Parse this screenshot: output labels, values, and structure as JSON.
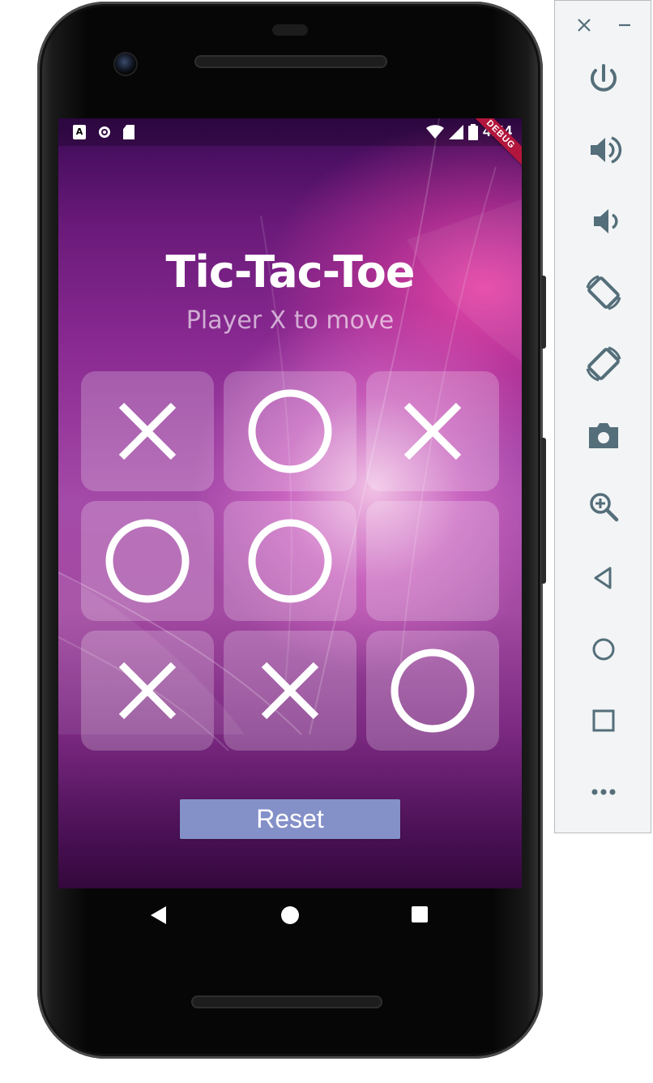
{
  "app": {
    "title": "Tic-Tac-Toe",
    "status": "Player X to move",
    "reset_label": "Reset",
    "colors": {
      "cell_background": "rgba(255,255,255,0.22)",
      "mark": "#ffffff",
      "reset_button": "#8490c8",
      "debug_ribbon": "#b3163c"
    }
  },
  "status_bar": {
    "time": "4:44",
    "left_icons": [
      "accessibility-a-icon",
      "screen-record-icon",
      "sd-card-icon"
    ],
    "right_icons": [
      "wifi-icon",
      "cell-signal-icon",
      "battery-icon"
    ],
    "debug_banner": "DEBUG"
  },
  "board": {
    "cells": [
      "X",
      "O",
      "X",
      "O",
      "O",
      "",
      "X",
      "X",
      "O"
    ]
  },
  "nav_bar": {
    "buttons": [
      "back-icon",
      "home-icon",
      "recents-icon"
    ]
  },
  "emulator_toolbar": {
    "window_controls": [
      "close-icon",
      "minimize-icon"
    ],
    "buttons": [
      {
        "name": "power-button",
        "icon": "power-icon"
      },
      {
        "name": "volume-up-button",
        "icon": "volume-up-icon"
      },
      {
        "name": "volume-down-button",
        "icon": "volume-down-icon"
      },
      {
        "name": "rotate-left-button",
        "icon": "rotate-left-icon"
      },
      {
        "name": "rotate-right-button",
        "icon": "rotate-right-icon"
      },
      {
        "name": "screenshot-button",
        "icon": "camera-icon"
      },
      {
        "name": "zoom-button",
        "icon": "zoom-in-icon"
      },
      {
        "name": "back-button",
        "icon": "back-triangle-icon"
      },
      {
        "name": "home-button",
        "icon": "home-circle-icon"
      },
      {
        "name": "overview-button",
        "icon": "overview-square-icon"
      },
      {
        "name": "more-button",
        "icon": "more-dots-icon"
      }
    ],
    "icon_color": "#546e7a"
  }
}
